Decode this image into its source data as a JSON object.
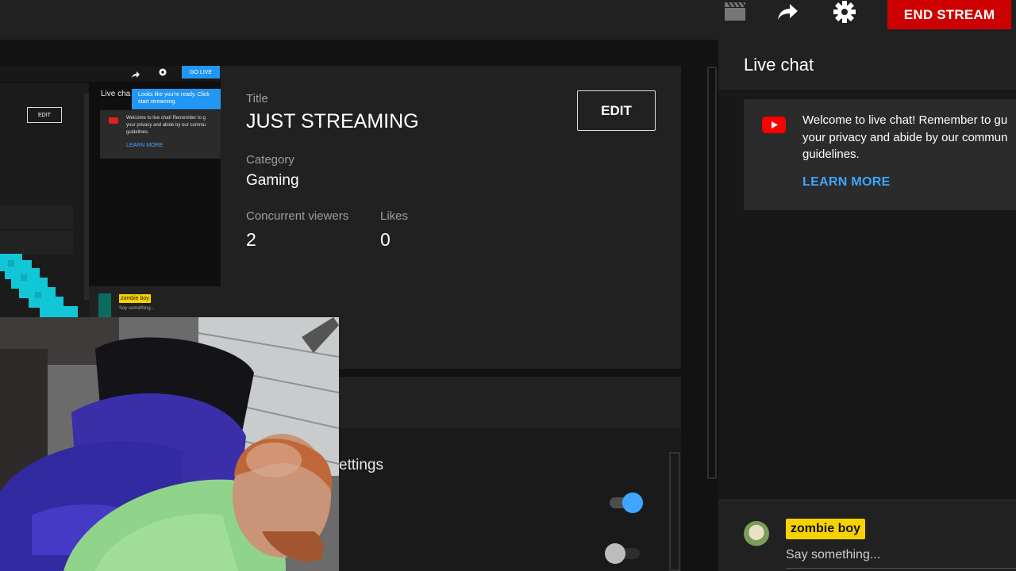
{
  "topbar": {
    "icons": [
      "clapperboard-icon",
      "share-icon",
      "gear-icon"
    ],
    "end_stream_label": "END STREAM"
  },
  "stream": {
    "title_label": "Title",
    "title_value": "JUST STREAMING",
    "edit_label": "EDIT",
    "category_label": "Category",
    "category_value": "Gaming",
    "viewers_label": "Concurrent viewers",
    "viewers_value": "2",
    "likes_label": "Likes",
    "likes_value": "0"
  },
  "settings": {
    "partial_label": "ettings",
    "toggles": [
      {
        "state": "on",
        "color": "#3ea6ff"
      },
      {
        "state": "off",
        "color": "#bdbdbd"
      }
    ]
  },
  "preview": {
    "go_live": "GO LIVE",
    "live_chat": "Live cha",
    "tooltip": "Looks like you're ready. Click start streaming.",
    "edit": "EDIT",
    "welcome_lines": [
      "Welcome to live chat! Remember to g",
      "your privacy and abide by our commu",
      "guidelines."
    ],
    "learn_more": "LEARN MORE",
    "user": "zombie boy",
    "say": "Say something..."
  },
  "chat": {
    "title": "Live chat",
    "welcome_lines": [
      "Welcome to live chat! Remember to gu",
      "your privacy and abide by our commun",
      "guidelines."
    ],
    "learn_more": "LEARN MORE",
    "username": "zombie boy",
    "placeholder": "Say something..."
  },
  "colors": {
    "accent_red": "#cc0000",
    "link_blue": "#3ea6ff",
    "user_tag_yellow": "#f8d200"
  }
}
